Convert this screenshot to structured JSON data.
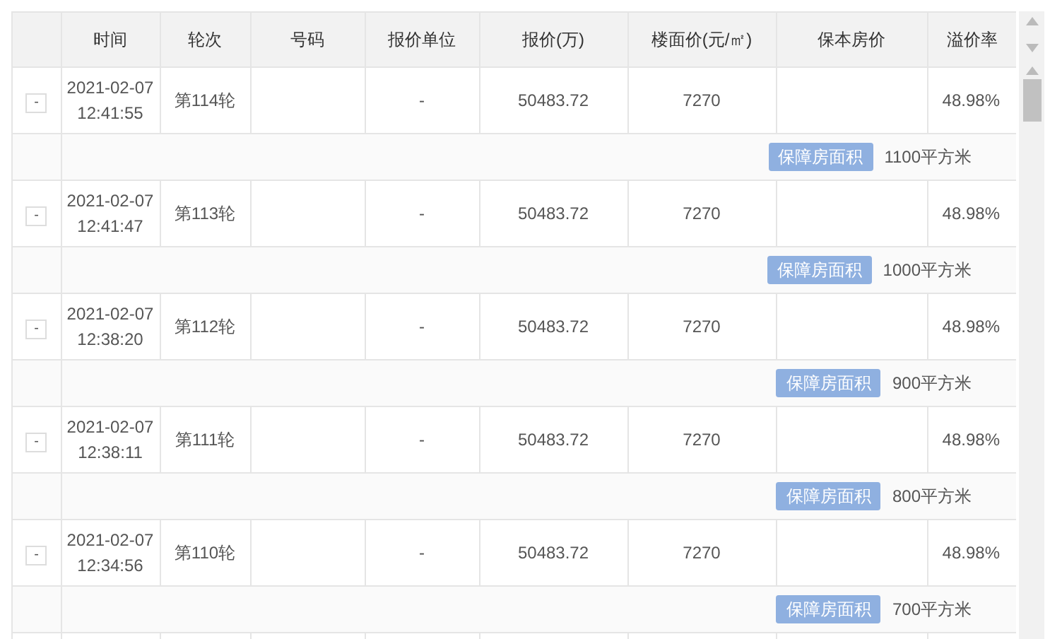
{
  "table": {
    "columns": [
      "时间",
      "轮次",
      "号码",
      "报价单位",
      "报价(万)",
      "楼面价(元/㎡)",
      "保本房价",
      "溢价率"
    ],
    "rows": [
      {
        "toggle": "-",
        "date": "2021-02-07",
        "time": "12:41:55",
        "round": "第114轮",
        "number": "",
        "unit": "-",
        "price": "50483.72",
        "floor_price": "7270",
        "break_even": "",
        "premium": "48.98%",
        "tag": "保障房面积",
        "area": "1100平方米"
      },
      {
        "toggle": "-",
        "date": "2021-02-07",
        "time": "12:41:47",
        "round": "第113轮",
        "number": "",
        "unit": "-",
        "price": "50483.72",
        "floor_price": "7270",
        "break_even": "",
        "premium": "48.98%",
        "tag": "保障房面积",
        "area": "1000平方米"
      },
      {
        "toggle": "-",
        "date": "2021-02-07",
        "time": "12:38:20",
        "round": "第112轮",
        "number": "",
        "unit": "-",
        "price": "50483.72",
        "floor_price": "7270",
        "break_even": "",
        "premium": "48.98%",
        "tag": "保障房面积",
        "area": "900平方米"
      },
      {
        "toggle": "-",
        "date": "2021-02-07",
        "time": "12:38:11",
        "round": "第111轮",
        "number": "",
        "unit": "-",
        "price": "50483.72",
        "floor_price": "7270",
        "break_even": "",
        "premium": "48.98%",
        "tag": "保障房面积",
        "area": "800平方米"
      },
      {
        "toggle": "-",
        "date": "2021-02-07",
        "time": "12:34:56",
        "round": "第110轮",
        "number": "",
        "unit": "-",
        "price": "50483.72",
        "floor_price": "7270",
        "break_even": "",
        "premium": "48.98%",
        "tag": "保障房面积",
        "area": "700平方米"
      }
    ]
  }
}
